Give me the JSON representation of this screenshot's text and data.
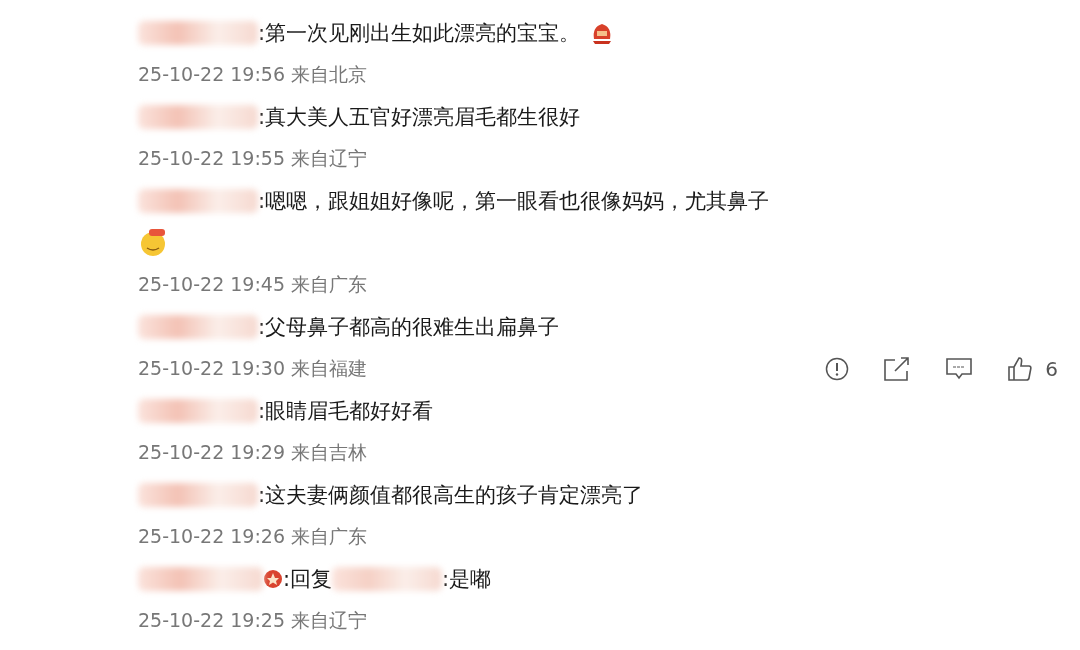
{
  "comments": [
    {
      "kind": "comment",
      "text": ":第一次见刚出生如此漂亮的宝宝。",
      "inline_emoji": {
        "kind": "lantern"
      },
      "meta": "25-10-22 19:56 来自北京"
    },
    {
      "kind": "comment",
      "text": ":真大美人五官好漂亮眉毛都生很好",
      "meta": "25-10-22 19:55 来自辽宁"
    },
    {
      "kind": "comment",
      "text": ":嗯嗯，跟姐姐好像呢，第一眼看也很像妈妈，尤其鼻子",
      "line_emoji": {
        "kind": "face"
      },
      "meta": "25-10-22 19:45 来自广东"
    },
    {
      "kind": "comment",
      "text": ":父母鼻子都高的很难生出扁鼻子",
      "meta": "25-10-22 19:30 来自福建",
      "actions": {
        "like_count": "6"
      }
    },
    {
      "kind": "comment",
      "text": ":眼睛眉毛都好好看",
      "meta": "25-10-22 19:29 来自吉林"
    },
    {
      "kind": "comment",
      "text": ":这夫妻俩颜值都很高生的孩子肯定漂亮了",
      "meta": "25-10-22 19:26 来自广东"
    },
    {
      "kind": "reply",
      "reply_label": ":回复",
      "text": ":是嘟",
      "meta": "25-10-22 19:25 来自辽宁"
    }
  ]
}
